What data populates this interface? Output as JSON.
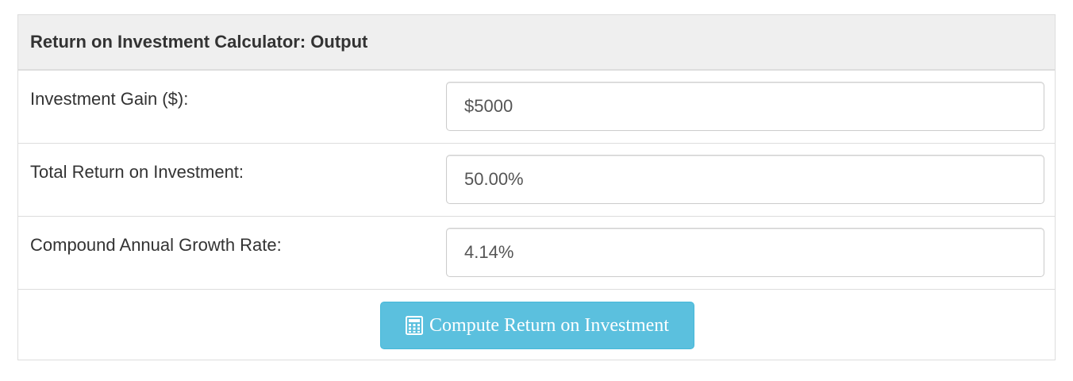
{
  "panel": {
    "title": "Return on Investment Calculator: Output"
  },
  "rows": [
    {
      "label": "Investment Gain ($):",
      "value": "$5000"
    },
    {
      "label": "Total Return on Investment:",
      "value": "50.00%"
    },
    {
      "label": "Compound Annual Growth Rate:",
      "value": "4.14%"
    }
  ],
  "button": {
    "label": "Compute Return on Investment",
    "icon": "calculator-icon",
    "color": "#5bc0de"
  }
}
